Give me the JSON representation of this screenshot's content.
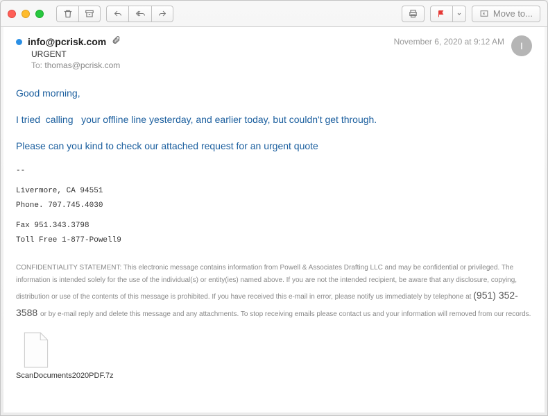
{
  "toolbar": {
    "move_label": "Move to..."
  },
  "message": {
    "sender": "info@pcrisk.com",
    "subject": "URGENT",
    "to_label": "To:",
    "to": "thomas@pcrisk.com",
    "date": "November 6, 2020 at 9:12 AM",
    "avatar_initial": "I"
  },
  "body": {
    "greeting": "Good morning,",
    "line1": "I tried  calling   your offline line yesterday, and earlier today, but couldn't get through.",
    "line2": "Please can you kind to check our attached request for an urgent quote"
  },
  "signature": {
    "sep": "--",
    "city": "Livermore, CA 94551",
    "phone": "Phone. 707.745.4030",
    "fax": "Fax 951.343.3798",
    "tollfree": "Toll Free 1-877-Powell9"
  },
  "confidentiality": {
    "label": "CONFIDENTIALITY STATEMENT:",
    "part1": " This electronic message contains information from Powell & Associates Drafting LLC and may be confidential or privileged. The information is intended solely for the use of the individual(s) or entity(ies) named above. If you are not the intended recipient, be aware that any disclosure, copying, distribution or use of the contents of this message is prohibited. If you have received this e-mail in error, please notify us immediately by telephone at ",
    "phone": " (951) 352-3588 ",
    "part2": "or by e-mail reply and delete this message and any attachments. To stop receiving emails please contact us and your information will removed from our records."
  },
  "attachment": {
    "name": "ScanDocuments2020PDF.7z"
  }
}
